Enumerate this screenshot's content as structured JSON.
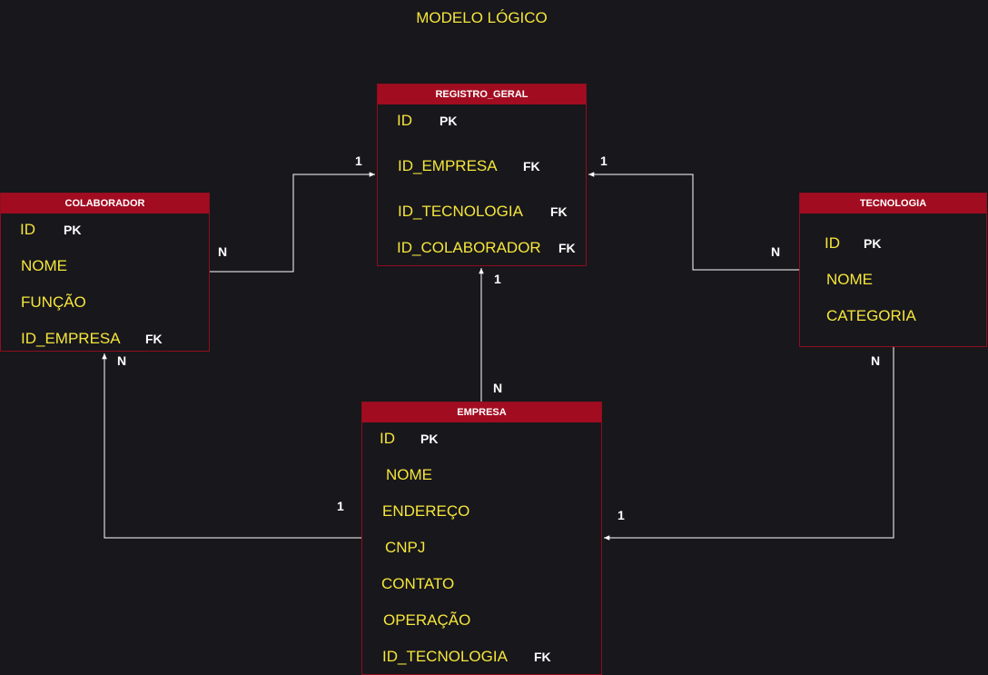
{
  "title": "MODELO LÓGICO",
  "colors": {
    "background": "#18171c",
    "header": "#a20c21",
    "field_text": "#f5e63a",
    "line": "#ffffff"
  },
  "entities": {
    "registro_geral": {
      "name": "REGISTRO_GERAL",
      "fields": [
        {
          "label": "ID",
          "key": "PK"
        },
        {
          "label": "ID_EMPRESA",
          "key": "FK"
        },
        {
          "label": "ID_TECNOLOGIA",
          "key": "FK"
        },
        {
          "label": "ID_COLABORADOR",
          "key": "FK"
        }
      ]
    },
    "colaborador": {
      "name": "COLABORADOR",
      "fields": [
        {
          "label": "ID",
          "key": "PK"
        },
        {
          "label": "NOME",
          "key": ""
        },
        {
          "label": "FUNÇÃO",
          "key": ""
        },
        {
          "label": "ID_EMPRESA",
          "key": "FK"
        }
      ]
    },
    "tecnologia": {
      "name": "TECNOLOGIA",
      "fields": [
        {
          "label": "ID",
          "key": "PK"
        },
        {
          "label": "NOME",
          "key": ""
        },
        {
          "label": "CATEGORIA",
          "key": ""
        }
      ]
    },
    "empresa": {
      "name": "EMPRESA",
      "fields": [
        {
          "label": "ID",
          "key": "PK"
        },
        {
          "label": "NOME",
          "key": ""
        },
        {
          "label": "ENDEREÇO",
          "key": ""
        },
        {
          "label": "CNPJ",
          "key": ""
        },
        {
          "label": "CONTATO",
          "key": ""
        },
        {
          "label": "OPERAÇÃO",
          "key": ""
        },
        {
          "label": "ID_TECNOLOGIA",
          "key": "FK"
        }
      ]
    }
  },
  "relationships": [
    {
      "from": "COLABORADOR",
      "to": "REGISTRO_GERAL",
      "from_card": "N",
      "to_card": "1"
    },
    {
      "from": "TECNOLOGIA",
      "to": "REGISTRO_GERAL",
      "from_card": "N",
      "to_card": "1"
    },
    {
      "from": "EMPRESA",
      "to": "REGISTRO_GERAL",
      "from_card": "N",
      "to_card": "1"
    },
    {
      "from": "EMPRESA",
      "to": "COLABORADOR",
      "from_card": "1",
      "to_card": "N"
    },
    {
      "from": "TECNOLOGIA",
      "to": "EMPRESA",
      "from_card": "N",
      "to_card": "1"
    }
  ]
}
